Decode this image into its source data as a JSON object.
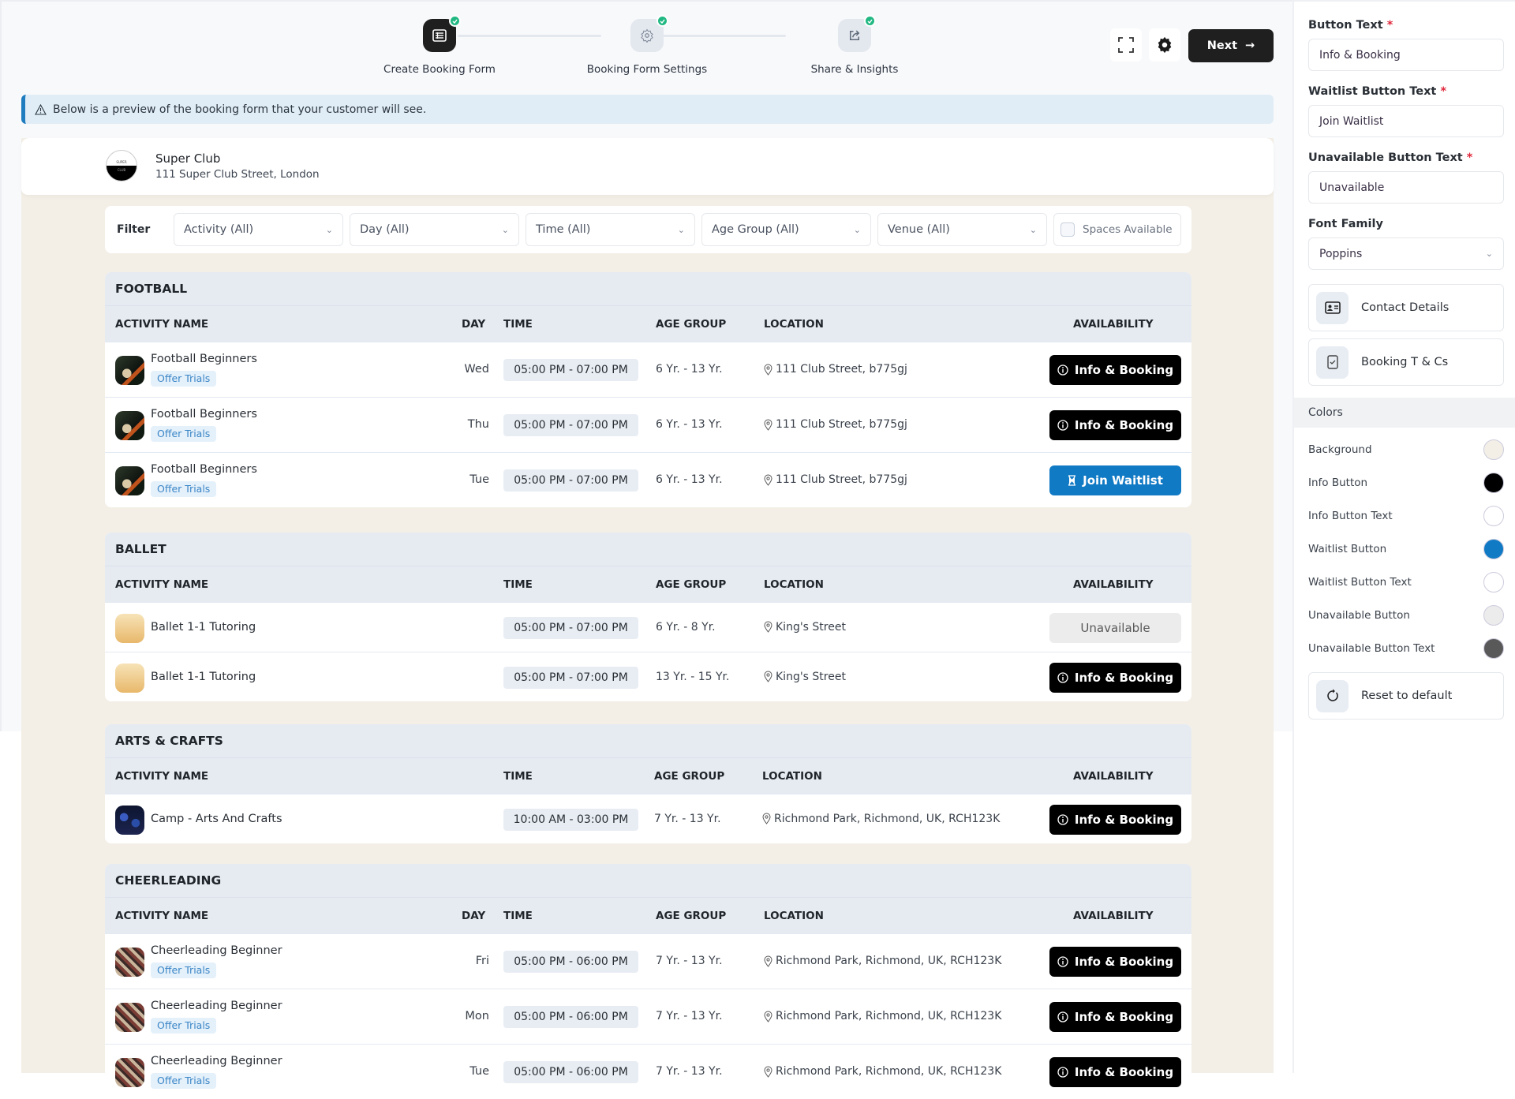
{
  "stepper": {
    "steps": [
      {
        "label": "Create Booking Form",
        "icon": "form-list-icon",
        "state": "active",
        "completed": true
      },
      {
        "label": "Booking Form Settings",
        "icon": "gear-icon",
        "state": "inactive",
        "completed": true
      },
      {
        "label": "Share & Insights",
        "icon": "share-icon",
        "state": "inactive",
        "completed": true
      }
    ]
  },
  "toolbar": {
    "fullscreen_icon": "fullscreen-icon",
    "settings_icon": "gear-icon",
    "next_label": "Next",
    "next_arrow": "→"
  },
  "notice": {
    "icon": "warning-triangle-icon",
    "text": "Below is a preview of the booking form that your customer will see."
  },
  "club": {
    "name": "Super Club",
    "address": "111 Super Club Street, London",
    "logo_text_top": "SUPER",
    "logo_text_bottom": "CLUB"
  },
  "filter": {
    "label": "Filter",
    "selects": [
      "Activity (All)",
      "Day (All)",
      "Time (All)",
      "Age Group (All)",
      "Venue (All)"
    ],
    "spaces_available": {
      "label": "Spaces Available",
      "checked": false
    }
  },
  "columns": {
    "activity": "ACTIVITY NAME",
    "day": "DAY",
    "time": "TIME",
    "age": "AGE GROUP",
    "location": "LOCATION",
    "availability": "AVAILABILITY"
  },
  "groups": [
    {
      "title": "FOOTBALL",
      "show_day": true,
      "rows": [
        {
          "name": "Football Beginners",
          "badge": "Offer Trials",
          "day": "Wed",
          "time": "05:00 PM - 07:00 PM",
          "age": "6 Yr. - 13 Yr.",
          "location": "111 Club Street, b775gj",
          "action": "Info & Booking",
          "type": "info",
          "thumb": "foot"
        },
        {
          "name": "Football Beginners",
          "badge": "Offer Trials",
          "day": "Thu",
          "time": "05:00 PM - 07:00 PM",
          "age": "6 Yr. - 13 Yr.",
          "location": "111 Club Street, b775gj",
          "action": "Info & Booking",
          "type": "info",
          "thumb": "foot"
        },
        {
          "name": "Football Beginners",
          "badge": "Offer Trials",
          "day": "Tue",
          "time": "05:00 PM - 07:00 PM",
          "age": "6 Yr. - 13 Yr.",
          "location": "111 Club Street, b775gj",
          "action": "Join Waitlist",
          "type": "wait",
          "thumb": "foot"
        }
      ]
    },
    {
      "title": "BALLET",
      "show_day": false,
      "rows": [
        {
          "name": "Ballet 1-1 Tutoring",
          "badge": "",
          "day": "",
          "time": "05:00 PM - 07:00 PM",
          "age": "6 Yr. - 8 Yr.",
          "location": "King's Street",
          "action": "Unavailable",
          "type": "unav",
          "thumb": "ballet"
        },
        {
          "name": "Ballet 1-1 Tutoring",
          "badge": "",
          "day": "",
          "time": "05:00 PM - 07:00 PM",
          "age": "13 Yr. - 15 Yr.",
          "location": "King's Street",
          "action": "Info & Booking",
          "type": "info",
          "thumb": "ballet"
        }
      ]
    },
    {
      "title": "ARTS & CRAFTS",
      "show_day": false,
      "rows": [
        {
          "name": "Camp - Arts And Crafts",
          "badge": "",
          "day": "",
          "time": "10:00 AM - 03:00 PM",
          "age": "7 Yr. - 13 Yr.",
          "location": "Richmond Park, Richmond, UK, RCH123K",
          "action": "Info & Booking",
          "type": "info",
          "thumb": "arts"
        }
      ]
    },
    {
      "title": "CHEERLEADING",
      "show_day": true,
      "rows": [
        {
          "name": "Cheerleading Beginner",
          "badge": "Offer Trials",
          "day": "Fri",
          "time": "05:00 PM - 06:00 PM",
          "age": "7 Yr. - 13 Yr.",
          "location": "Richmond Park, Richmond, UK, RCH123K",
          "action": "Info & Booking",
          "type": "info",
          "thumb": "cheer"
        },
        {
          "name": "Cheerleading Beginner",
          "badge": "Offer Trials",
          "day": "Mon",
          "time": "05:00 PM - 06:00 PM",
          "age": "7 Yr. - 13 Yr.",
          "location": "Richmond Park, Richmond, UK, RCH123K",
          "action": "Info & Booking",
          "type": "info",
          "thumb": "cheer"
        },
        {
          "name": "Cheerleading Beginner",
          "badge": "Offer Trials",
          "day": "Tue",
          "time": "05:00 PM - 06:00 PM",
          "age": "7 Yr. - 13 Yr.",
          "location": "Richmond Park, Richmond, UK, RCH123K",
          "action": "Info & Booking",
          "type": "info",
          "thumb": "cheer"
        }
      ]
    }
  ],
  "panel": {
    "button_text": {
      "label": "Button Text",
      "value": "Info & Booking"
    },
    "waitlist_text": {
      "label": "Waitlist Button Text",
      "value": "Join Waitlist"
    },
    "unavailable_text": {
      "label": "Unavailable Button Text",
      "value": "Unavailable"
    },
    "font_family": {
      "label": "Font Family",
      "value": "Poppins"
    },
    "required_mark": "*",
    "cards": [
      {
        "label": "Contact Details",
        "icon": "contact-card-icon"
      },
      {
        "label": "Booking T & Cs",
        "icon": "checkbox-doc-icon"
      }
    ],
    "colors_header": "Colors",
    "colors": [
      {
        "label": "Background",
        "hex": "#f3efe7"
      },
      {
        "label": "Info Button",
        "hex": "#000000"
      },
      {
        "label": "Info Button Text",
        "hex": "#ffffff"
      },
      {
        "label": "Waitlist Button",
        "hex": "#117ac5"
      },
      {
        "label": "Waitlist Button Text",
        "hex": "#ffffff"
      },
      {
        "label": "Unavailable Button",
        "hex": "#ececec"
      },
      {
        "label": "Unavailable Button Text",
        "hex": "#595959"
      }
    ],
    "reset_label": "Reset to default"
  }
}
